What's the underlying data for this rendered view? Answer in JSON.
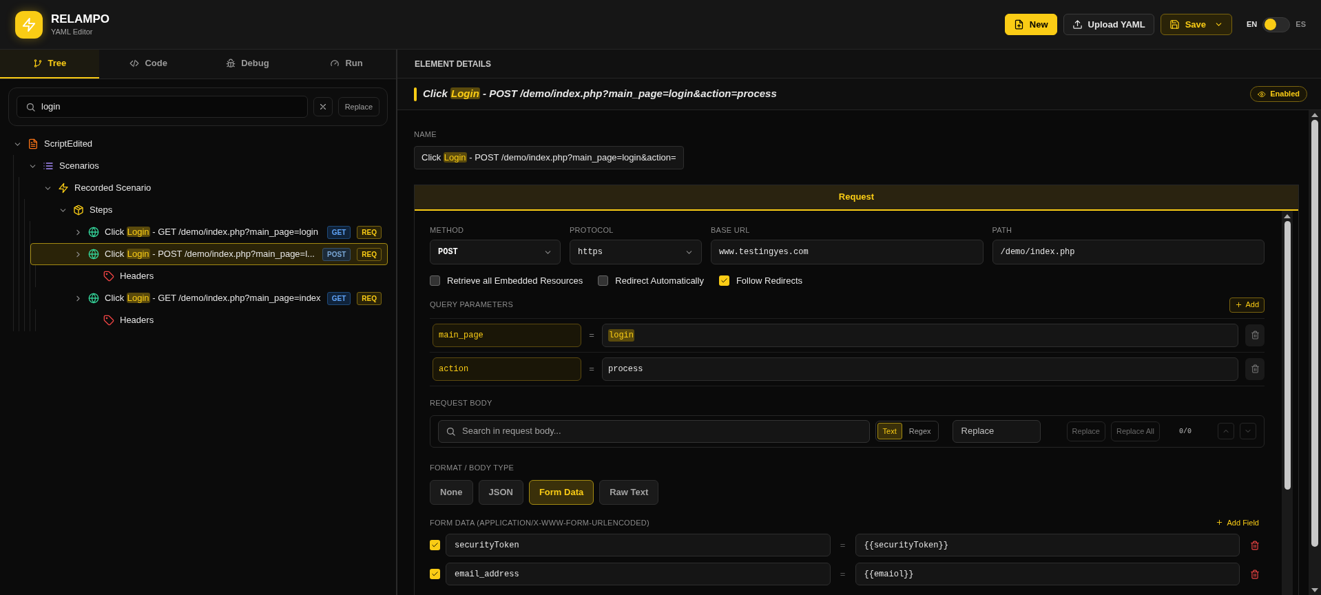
{
  "app": {
    "name": "RELAMPO",
    "subtitle": "YAML Editor"
  },
  "header_actions": [
    {
      "label": "New",
      "kind": "primary"
    },
    {
      "label": "Upload YAML",
      "kind": "upload"
    },
    {
      "label": "Save",
      "kind": "save"
    }
  ],
  "languages": [
    {
      "label": "EN",
      "selected": true
    },
    {
      "label": "ES",
      "selected": false
    }
  ],
  "tabs": [
    {
      "label": "Tree",
      "kind": "tree",
      "selected": true
    },
    {
      "label": "Code",
      "kind": "code",
      "selected": false
    },
    {
      "label": "Debug",
      "kind": "debug",
      "selected": false
    },
    {
      "label": "Run",
      "kind": "run",
      "selected": false
    }
  ],
  "search": {
    "value": "login",
    "replace_button": "Replace"
  },
  "tree": [
    {
      "kind": "document",
      "label": "ScriptEdited",
      "expanded": true,
      "selected": false,
      "children": [
        {
          "kind": "list",
          "label": "Scenarios",
          "expanded": true,
          "selected": false,
          "children": [
            {
              "kind": "bolt",
              "label": "Recorded Scenario",
              "expanded": true,
              "selected": false,
              "children": [
                {
                  "kind": "box",
                  "label": "Steps",
                  "expanded": true,
                  "selected": false,
                  "children": [
                    {
                      "kind": "globe",
                      "label": {
                        "before": "Click ",
                        "match": "Login",
                        "after": " - GET /demo/index.php?main_page=login"
                      },
                      "expanded": false,
                      "selected": false,
                      "badges": [
                        {
                          "label": "GET",
                          "kind": "get"
                        },
                        {
                          "label": "REQ",
                          "kind": "req"
                        }
                      ]
                    },
                    {
                      "kind": "globe",
                      "label": {
                        "before": "Click ",
                        "match": "Login",
                        "after": " - POST /demo/index.php?main_page=l..."
                      },
                      "expanded": false,
                      "selected": true,
                      "badges": [
                        {
                          "label": "POST",
                          "kind": "post"
                        },
                        {
                          "label": "REQ",
                          "kind": "req"
                        }
                      ],
                      "children": [
                        {
                          "kind": "tag",
                          "label": "Headers",
                          "selected": false
                        }
                      ]
                    },
                    {
                      "kind": "globe",
                      "label": {
                        "before": "Click ",
                        "match": "Login",
                        "after": " - GET /demo/index.php?main_page=index"
                      },
                      "expanded": false,
                      "selected": false,
                      "badges": [
                        {
                          "label": "GET",
                          "kind": "get"
                        },
                        {
                          "label": "REQ",
                          "kind": "req"
                        }
                      ],
                      "children": [
                        {
                          "kind": "tag",
                          "label": "Headers",
                          "selected": false
                        }
                      ]
                    }
                  ]
                }
              ]
            }
          ]
        }
      ]
    }
  ],
  "details": {
    "heading": "ELEMENT DETAILS",
    "title": {
      "before": "Click ",
      "match": "Login",
      "after": " - POST /demo/index.php?main_page=login&action=process"
    },
    "enabled_label": "Enabled",
    "enabled": true,
    "name_label": "NAME",
    "name_value": {
      "before": "Click ",
      "match": "Login",
      "after": " - POST /demo/index.php?main_page=login&action="
    },
    "section_tab": "Request",
    "fields": [
      {
        "label": "METHOD",
        "value": "POST",
        "kind": "select"
      },
      {
        "label": "PROTOCOL",
        "value": "https",
        "kind": "select"
      },
      {
        "label": "BASE URL",
        "value": "www.testingyes.com",
        "kind": "text"
      },
      {
        "label": "PATH",
        "value": "/demo/index.php",
        "kind": "text"
      }
    ],
    "options": [
      {
        "label": "Retrieve all Embedded Resources",
        "checked": false
      },
      {
        "label": "Redirect Automatically",
        "checked": false
      },
      {
        "label": "Follow Redirects",
        "checked": true
      }
    ],
    "query_parameters": {
      "label": "QUERY PARAMETERS",
      "add_button": "Add",
      "rows": [
        {
          "key": "main_page",
          "separator": "=",
          "value": "login",
          "highlighted": true
        },
        {
          "key": "action",
          "separator": "=",
          "value": "process",
          "highlighted": false
        }
      ]
    },
    "request_body": {
      "label": "REQUEST BODY",
      "search_placeholder": "Search in request body...",
      "modes": [
        {
          "label": "Text",
          "selected": true
        },
        {
          "label": "Regex",
          "selected": false
        }
      ],
      "replace_placeholder": "Replace",
      "buttons": [
        "Replace",
        "Replace All"
      ],
      "count": "0/0"
    },
    "format": {
      "label": "FORMAT / BODY TYPE",
      "options": [
        {
          "label": "None",
          "selected": false
        },
        {
          "label": "JSON",
          "selected": false
        },
        {
          "label": "Form Data",
          "selected": true
        },
        {
          "label": "Raw Text",
          "selected": false
        }
      ]
    },
    "form_data": {
      "label": "FORM DATA (APPLICATION/X-WWW-FORM-URLENCODED)",
      "add_button": "Add Field",
      "rows": [
        {
          "checked": true,
          "key": "securityToken",
          "separator": "=",
          "value": "{{securityToken}}"
        },
        {
          "checked": true,
          "key": "email_address",
          "separator": "=",
          "value": "{{emaiol}}"
        }
      ]
    }
  }
}
